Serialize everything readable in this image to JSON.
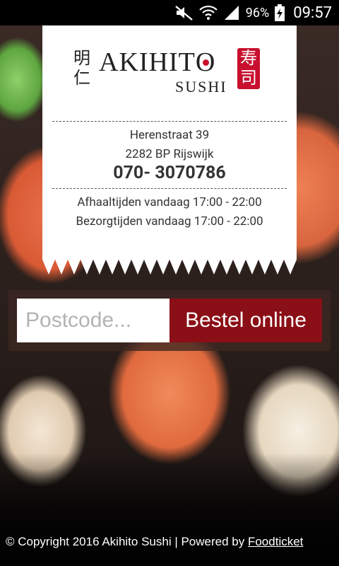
{
  "status_bar": {
    "battery_percent": "96%",
    "time": "09:57",
    "icons": [
      "mute-icon",
      "wifi-icon",
      "signal-icon",
      "battery-charging-icon"
    ]
  },
  "logo": {
    "kanji_left": "明仁",
    "brand_name": "AKIHITO",
    "brand_sub": "SUSHI",
    "stamp_kanji": "寿司",
    "accent_color": "#c8102e"
  },
  "contact": {
    "street": "Herenstraat 39",
    "postal_city": "2282 BP Rijswijk",
    "phone": "070- 3070786",
    "pickup_hours": "Afhaaltijden vandaag 17:00 - 22:00",
    "delivery_hours": "Bezorgtijden vandaag 17:00 - 22:00"
  },
  "order": {
    "postcode_placeholder": "Postcode...",
    "postcode_value": "",
    "button_label": "Bestel online",
    "button_color": "#8b0f16"
  },
  "footer": {
    "copyright": "© Copyright 2016 Akihito Sushi | Powered by ",
    "powered_link": "Foodticket"
  }
}
